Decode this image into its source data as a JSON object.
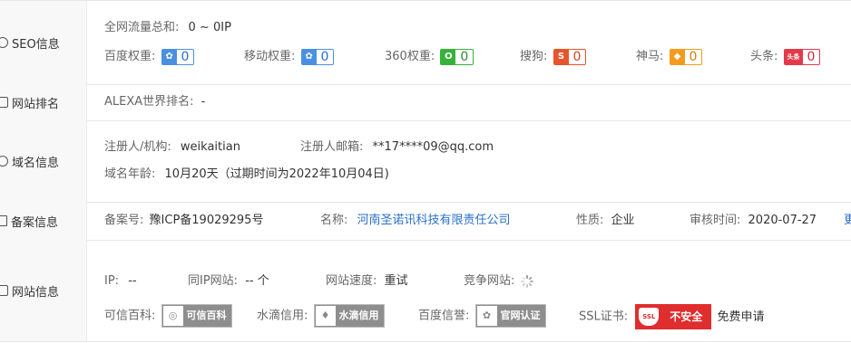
{
  "seo": {
    "header": "SEO信息",
    "traffic_label": "全网流量总和:",
    "traffic_value": "0 ~ 0IP",
    "weights": [
      {
        "label": "百度权重:",
        "value": "0",
        "icon": "baidu-paw-icon",
        "color": "#4a90e2"
      },
      {
        "label": "移动权重:",
        "value": "0",
        "icon": "mobile-paw-icon",
        "color": "#4a90e2"
      },
      {
        "label": "360权重:",
        "value": "0",
        "icon": "360-icon",
        "color": "#37b13a"
      },
      {
        "label": "搜狗:",
        "value": "0",
        "icon": "sogou-icon",
        "color": "#e8542b"
      },
      {
        "label": "神马:",
        "value": "0",
        "icon": "shenma-icon",
        "color": "#f39b1d"
      },
      {
        "label": "头条:",
        "value": "0",
        "icon": "toutiao-icon",
        "color": "#e23a4a"
      }
    ]
  },
  "rank": {
    "header": "网站排名",
    "alexa_label": "ALEXA世界排名:",
    "alexa_value": "-"
  },
  "domain": {
    "header": "域名信息",
    "registrant_label": "注册人/机构:",
    "registrant_value": "weikaitian",
    "email_label": "注册人邮箱:",
    "email_value": "**17****09@qq.com",
    "age_label": "域名年龄:",
    "age_value": "10月20天（过期时间为2022年10月04日)"
  },
  "icp": {
    "header": "备案信息",
    "no_label": "备案号:",
    "no_value": "豫ICP备19029295号",
    "name_label": "名称:",
    "name_value": "河南圣诺讯科技有限责任公司",
    "type_label": "性质:",
    "type_value": "企业",
    "date_label": "审核时间:",
    "date_value": "2020-07-27",
    "more_label": "更"
  },
  "site": {
    "header": "网站信息",
    "ip_label": "IP:",
    "ip_value": "--",
    "sameip_label": "同IP网站:",
    "sameip_value": "-- 个",
    "speed_label": "网站速度:",
    "speed_value": "重试",
    "competitor_label": "竞争网站:",
    "kexin_label": "可信百科:",
    "kexin_badge": "可信百科",
    "shuidi_label": "水滴信用:",
    "shuidi_badge": "水滴信用",
    "baidu_label": "百度信誉:",
    "baidu_badge": "官网认证",
    "ssl_label": "SSL证书:",
    "ssl_badge_icon": "SSL",
    "ssl_badge": "不安全",
    "ssl_apply": "免费申请"
  },
  "colors": {
    "accent": "#2a6fc8",
    "danger": "#e02d2d",
    "header_bg": "#f8f8f8",
    "border": "#e6e6e6"
  }
}
